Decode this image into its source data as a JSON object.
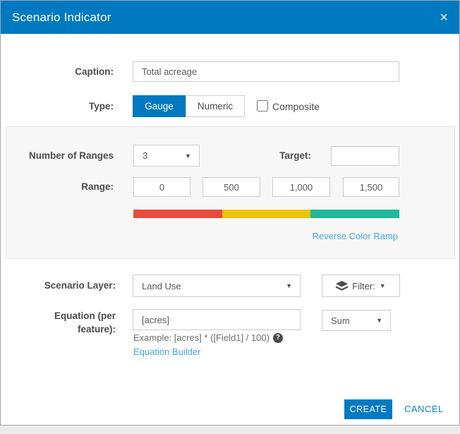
{
  "dialog": {
    "title": "Scenario Indicator",
    "close_icon": "×"
  },
  "caption": {
    "label": "Caption:",
    "value": "Total acreage"
  },
  "type": {
    "label": "Type:",
    "gauge_label": "Gauge",
    "numeric_label": "Numeric",
    "selected_option": "Gauge",
    "composite_label": "Composite",
    "composite_checked": false
  },
  "ranges": {
    "number_label": "Number of Ranges",
    "number_value": "3",
    "dropdown_caret": "▼",
    "target_label": "Target:",
    "target_value": "",
    "range_label": "Range:",
    "values": [
      "0",
      "500",
      "1,000",
      "1,500"
    ],
    "ramp_colors": [
      "#e74c3c",
      "#edc20f",
      "#1eb998"
    ],
    "reverse_link_label": "Reverse Color Ramp"
  },
  "layer": {
    "label": "Scenario Layer:",
    "value": "Land Use",
    "filter_label": "Filter:"
  },
  "equation": {
    "label": "Equation (per feature):",
    "value": "[acres]",
    "example_text": "Example: [acres] * ([Field1] / 100)",
    "help_icon": "?",
    "builder_link_label": "Equation Builder",
    "aggregation_value": "Sum"
  },
  "footer": {
    "create_label": "CREATE",
    "cancel_label": "CANCEL"
  },
  "colors": {
    "accent": "#0079c1",
    "link_light": "#45a5dc"
  }
}
